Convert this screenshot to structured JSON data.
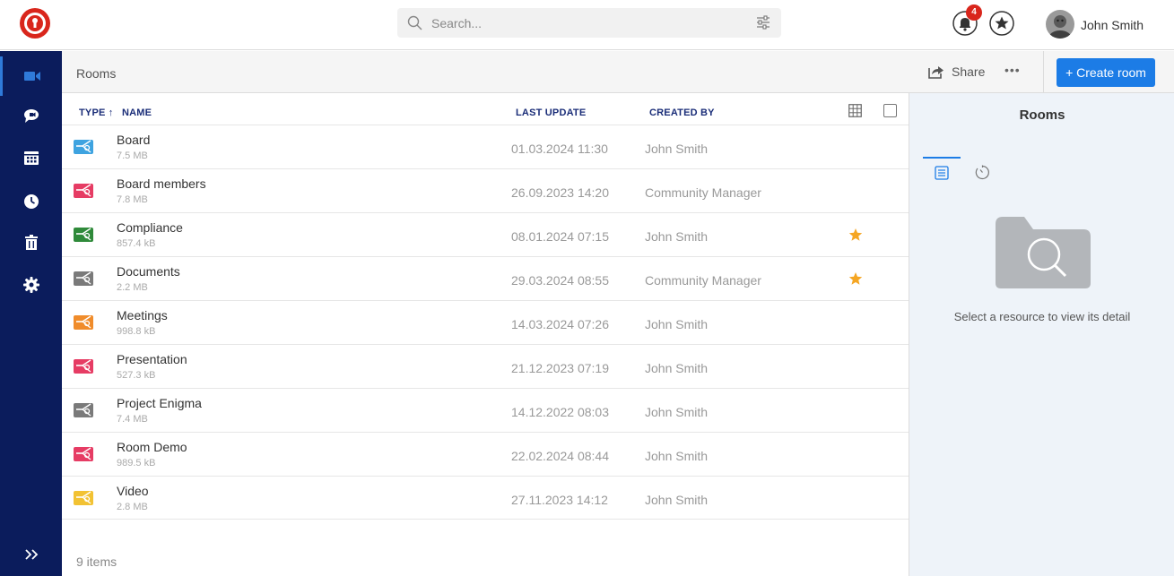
{
  "header": {
    "search_placeholder": "Search...",
    "notification_count": "4",
    "user_name": "John Smith",
    "colors": {
      "brand": "#d9261c",
      "accent": "#1c7ce6",
      "sidebar": "#0b1c5c"
    }
  },
  "sidebar": {
    "items": [
      {
        "icon": "video-camera-icon",
        "active": true
      },
      {
        "icon": "chat-icon",
        "active": false
      },
      {
        "icon": "calendar-icon",
        "active": false
      },
      {
        "icon": "clock-icon",
        "active": false
      },
      {
        "icon": "trash-icon",
        "active": false
      },
      {
        "icon": "gear-icon",
        "active": false
      }
    ],
    "expand_icon": "double-chevron-right-icon"
  },
  "toolbar": {
    "breadcrumb": "Rooms",
    "share_label": "Share",
    "more_label": "•••",
    "create_label": "+ Create room"
  },
  "table": {
    "headers": {
      "type": "TYPE ↑",
      "name": "NAME",
      "last_update": "LAST UPDATE",
      "created_by": "CREATED BY"
    },
    "rows": [
      {
        "name": "Board",
        "size": "7.5 MB",
        "last_update": "01.03.2024 11:30",
        "created_by": "John Smith",
        "color": "#3ea3e0",
        "favorite": false
      },
      {
        "name": "Board members",
        "size": "7.8 MB",
        "last_update": "26.09.2023 14:20",
        "created_by": "Community Manager",
        "color": "#e63c64",
        "favorite": false
      },
      {
        "name": "Compliance",
        "size": "857.4 kB",
        "last_update": "08.01.2024 07:15",
        "created_by": "John Smith",
        "color": "#2f8a3a",
        "favorite": true
      },
      {
        "name": "Documents",
        "size": "2.2 MB",
        "last_update": "29.03.2024 08:55",
        "created_by": "Community Manager",
        "color": "#7a7a7a",
        "favorite": true
      },
      {
        "name": "Meetings",
        "size": "998.8 kB",
        "last_update": "14.03.2024 07:26",
        "created_by": "John Smith",
        "color": "#f08c2b",
        "favorite": false
      },
      {
        "name": "Presentation",
        "size": "527.3 kB",
        "last_update": "21.12.2023 07:19",
        "created_by": "John Smith",
        "color": "#e63c64",
        "favorite": false
      },
      {
        "name": "Project Enigma",
        "size": "7.4 MB",
        "last_update": "14.12.2022 08:03",
        "created_by": "John Smith",
        "color": "#7a7a7a",
        "favorite": false
      },
      {
        "name": "Room Demo",
        "size": "989.5 kB",
        "last_update": "22.02.2024 08:44",
        "created_by": "John Smith",
        "color": "#e63c64",
        "favorite": false
      },
      {
        "name": "Video",
        "size": "2.8 MB",
        "last_update": "27.11.2023 14:12",
        "created_by": "John Smith",
        "color": "#f2c233",
        "favorite": false
      }
    ],
    "item_count": "9 items"
  },
  "detail": {
    "title": "Rooms",
    "tabs": [
      {
        "icon": "list-icon",
        "active": true
      },
      {
        "icon": "timer-icon",
        "active": false
      }
    ],
    "empty_message": "Select a resource to view its detail"
  }
}
